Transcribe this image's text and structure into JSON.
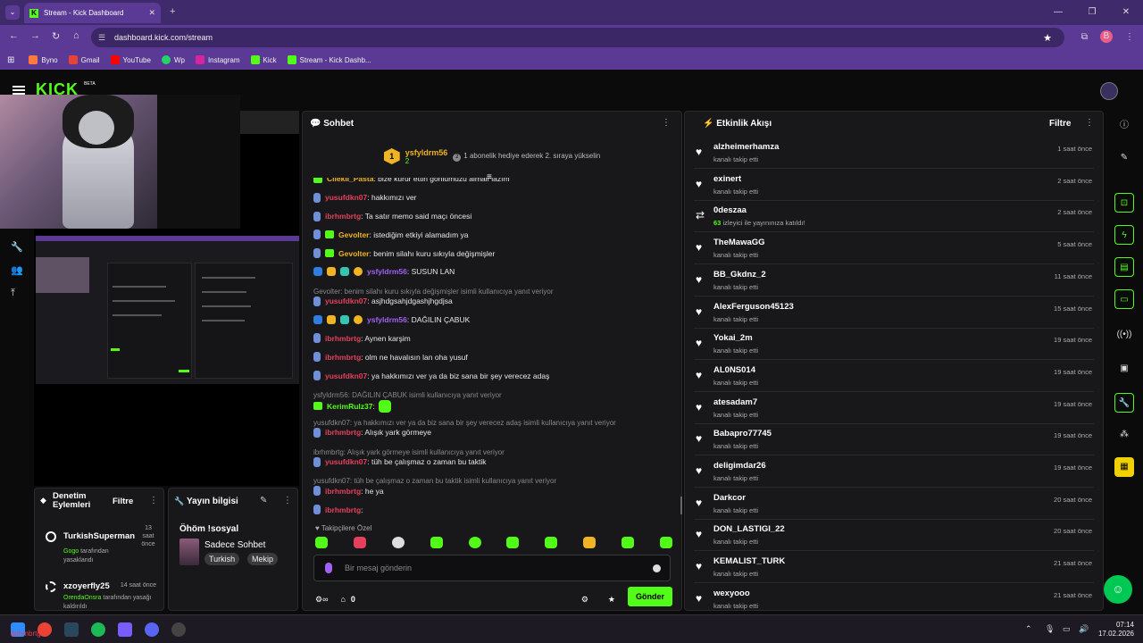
{
  "browser": {
    "tab_title": "Stream - Kick Dashboard",
    "tab_favicon": "K",
    "url": "dashboard.kick.com/stream",
    "profile_initial": "B",
    "bookmarks": [
      "Byno",
      "Gmail",
      "YouTube",
      "Wp",
      "Instagram",
      "Kick",
      "Stream - Kick Dashb..."
    ]
  },
  "kick": {
    "logo": "KICK",
    "beta": "BETA"
  },
  "chat": {
    "title": "Sohbet",
    "pinned": {
      "badge": "1",
      "user": "ysfyldrm56",
      "count": "2",
      "step": "2",
      "message": "1 abonelik hediye ederek 2. sıraya yükselin"
    },
    "messages": [
      {
        "user": "Cilekli_Pasta",
        "text": ": bize kurur ettin gonlumuzu almalı lazım",
        "color": "yel",
        "icons": [
          "g"
        ]
      },
      {
        "user": "yusufdkn07",
        "text": ": hakkımızı ver",
        "color": "red",
        "icons": [
          "b"
        ]
      },
      {
        "user": "ibrhmbrtg",
        "text": ": Ta satır memo said maçı öncesi",
        "color": "red",
        "icons": [
          "b"
        ]
      },
      {
        "user": "Gevolter",
        "text": ": istediğim etkiyi alamadım ya",
        "color": "yel",
        "icons": [
          "b",
          "g"
        ]
      },
      {
        "user": "Gevolter",
        "text": ": benim silahı kuru sıkıyla değişmişler",
        "color": "yel",
        "icons": [
          "b",
          "g"
        ]
      },
      {
        "user": "ysfyldrm56",
        "text": ": SUSUN LAN",
        "color": "pur",
        "icons": [
          "vip",
          "crown",
          "sub",
          "one"
        ]
      },
      {
        "reply": "Gevolter: benim silahı kuru sıkıyla değişmişler isimli kullanıcıya yanıt veriyor"
      },
      {
        "user": "yusufdkn07",
        "text": ": asjhdgsahjdgashjhgdjsa",
        "color": "red",
        "icons": [
          "b"
        ]
      },
      {
        "user": "ysfyldrm56",
        "text": ": DAĞILIN ÇABUK",
        "color": "pur",
        "icons": [
          "vip",
          "crown",
          "sub",
          "one"
        ]
      },
      {
        "user": "ibrhmbrtg",
        "text": ": Aynen karşim",
        "color": "red",
        "icons": [
          "b"
        ]
      },
      {
        "user": "ibrhmbrtg",
        "text": ": olm ne havalısın lan oha yusuf",
        "color": "red",
        "icons": [
          "b"
        ]
      },
      {
        "user": "yusufdkn07",
        "text": ": ya hakkımızı ver ya da biz sana bir şey verecez adaş",
        "color": "red",
        "icons": [
          "b"
        ]
      },
      {
        "reply": "ysfyldrm56: DAĞILIN ÇABUK isimli kullanıcıya yanıt veriyor"
      },
      {
        "user": "KerimRulz37",
        "text": ":",
        "color": "grn",
        "icons": [
          "g"
        ],
        "emote": true
      },
      {
        "reply": "yusufdkn07: ya hakkımızı ver ya da biz sana bir şey verecez adaş isimli kullanıcıya yanıt veriyor"
      },
      {
        "user": "ibrhmbrtg",
        "text": ": Alışık yark görmeye",
        "color": "red",
        "icons": [
          "b"
        ]
      },
      {
        "reply": "ibrhmbrtg: Alışık yark görmeye isimli kullanıcıya yanıt veriyor"
      },
      {
        "user": "yusufdkn07",
        "text": ": tüh be çalışmaz o zaman bu taktik",
        "color": "red",
        "icons": [
          "b"
        ]
      },
      {
        "reply": "yusufdkn07: tüh be çalışmaz o zaman bu taktik isimli kullanıcıya yanıt veriyor"
      },
      {
        "user": "ibrhmbrtg",
        "text": ": he ya",
        "color": "red",
        "icons": [
          "b"
        ]
      },
      {
        "user": "ibrhmbrtg",
        "text": ":",
        "color": "red",
        "icons": [
          "b"
        ]
      }
    ],
    "followers_only": "Takipçilere Özel",
    "input_placeholder": "Bir mesaj gönderin",
    "points": "0",
    "send_label": "Gönder"
  },
  "activity": {
    "title": "Etkinlik Akışı",
    "filter": "Filtre",
    "items": [
      {
        "name": "alzheimerhamza",
        "sub": "kanalı takip etti",
        "time": "1 saat önce"
      },
      {
        "name": "exinert",
        "sub": "kanalı takip etti",
        "time": "2 saat önce"
      },
      {
        "name": "0deszaa",
        "sub": "izleyici ile yayınınıza katıldı!",
        "count": "63",
        "time": "2 saat önce",
        "raid": true
      },
      {
        "name": "TheMawaGG",
        "sub": "kanalı takip etti",
        "time": "5 saat önce"
      },
      {
        "name": "BB_Gkdnz_2",
        "sub": "kanalı takip etti",
        "time": "11 saat önce"
      },
      {
        "name": "AlexFerguson45123",
        "sub": "kanalı takip etti",
        "time": "15 saat önce"
      },
      {
        "name": "Yokai_2m",
        "sub": "kanalı takip etti",
        "time": "19 saat önce"
      },
      {
        "name": "AL0NS014",
        "sub": "kanalı takip etti",
        "time": "19 saat önce"
      },
      {
        "name": "atesadam7",
        "sub": "kanalı takip etti",
        "time": "19 saat önce"
      },
      {
        "name": "Babapro77745",
        "sub": "kanalı takip etti",
        "time": "19 saat önce"
      },
      {
        "name": "deligimdar26",
        "sub": "kanalı takip etti",
        "time": "19 saat önce"
      },
      {
        "name": "Darkcor",
        "sub": "kanalı takip etti",
        "time": "20 saat önce"
      },
      {
        "name": "DON_LASTIGI_22",
        "sub": "kanalı takip etti",
        "time": "20 saat önce"
      },
      {
        "name": "KEMALIST_TURK",
        "sub": "kanalı takip etti",
        "time": "21 saat önce"
      },
      {
        "name": "wexyooo",
        "sub": "kanalı takip etti",
        "time": "21 saat önce"
      }
    ]
  },
  "moderation": {
    "title": "Denetim Eylemleri",
    "filter": "Filtre",
    "items": [
      {
        "name": "TurkishSuperman",
        "time": "13 saat önce",
        "by": "Gogo",
        "desc": "tarafından yasaklandı"
      },
      {
        "name": "xzoyerfly25",
        "time": "14 saat önce",
        "by": "OrendaOnsra",
        "desc": "tarafından yasağı kaldırıldı"
      }
    ]
  },
  "stream_info": {
    "title": "Yayın bilgisi",
    "stream_title": "Öhöm !sosyal",
    "category": "Sadece Sohbet",
    "tags": [
      "Turkish",
      "Mekip"
    ]
  },
  "taskbar": {
    "time": "07:14",
    "date": "17.02.2026",
    "user_label": "ibrhmbrtg"
  },
  "colors": {
    "kick_green": "#53fc18",
    "chrome_purple": "#5a3a95",
    "panel": "#18181b"
  }
}
